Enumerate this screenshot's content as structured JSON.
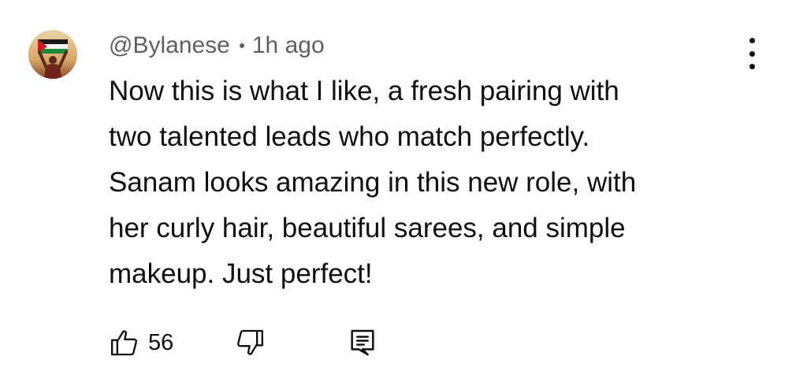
{
  "comment": {
    "author": "@Bylanese",
    "separator": "•",
    "timestamp": "1h ago",
    "text_lines": [
      "Now this is what I like, a fresh pairing with",
      "two talented leads who match perfectly.",
      "Sanam looks amazing in this new role, with",
      "her curly hair, beautiful sarees, and simple",
      "makeup. Just perfect!"
    ],
    "like_count": "56"
  },
  "icons": {
    "avatar": "user-avatar-flag",
    "menu": "more-vert-icon",
    "like": "thumbs-up-icon",
    "dislike": "thumbs-down-icon",
    "reply": "reply-comment-icon"
  },
  "colors": {
    "text_primary": "#0f0f0f",
    "text_secondary": "#606060",
    "background": "#ffffff"
  }
}
